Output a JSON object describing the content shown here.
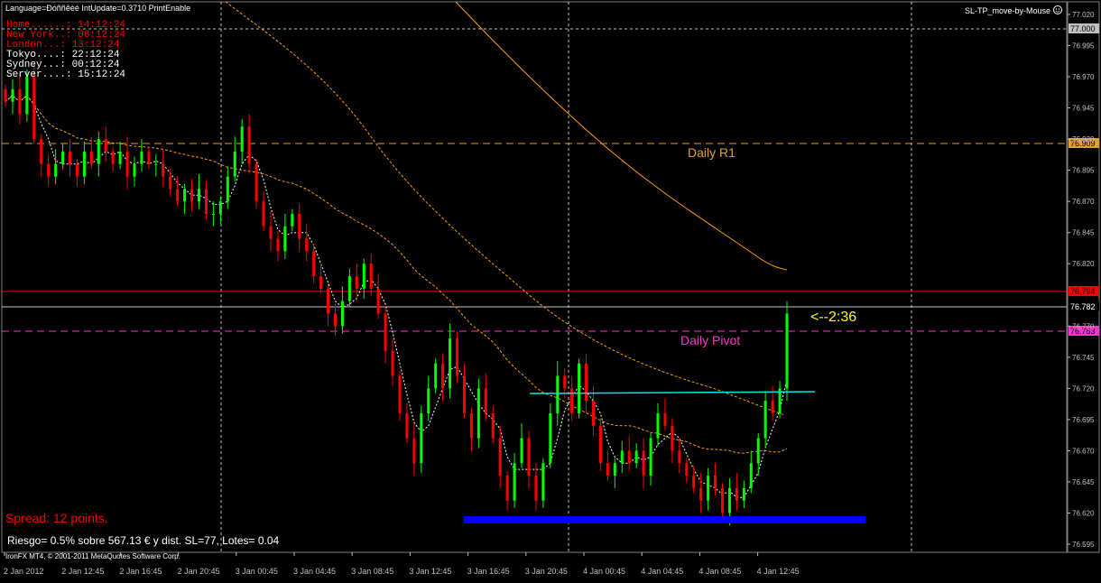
{
  "header": {
    "status_line": "Language=Ðóññêèé  IntUpdate=0.3710  PrintEnable",
    "indicator_name": "SL-TP_move-by-Mouse",
    "smiley_icon": "smiley-icon"
  },
  "clocks": [
    {
      "label": "Home......:",
      "time": "14:12:24",
      "color": "#ff0000"
    },
    {
      "label": "New York..:",
      "time": "08:12:24",
      "color": "#ff0000"
    },
    {
      "label": "London...:",
      "time": "13:12:24",
      "color": "#ff0000"
    },
    {
      "label": "Tokyo....:",
      "time": "22:12:24",
      "color": "#ffffff"
    },
    {
      "label": "Sydney...:",
      "time": "00:12:24",
      "color": "#ffffff"
    },
    {
      "label": "Server....:",
      "time": "15:12:24",
      "color": "#ffffff"
    }
  ],
  "levels": {
    "daily_r1": {
      "label": "Daily R1",
      "price": "76.909",
      "color": "#e0a030"
    },
    "daily_pivot": {
      "label": "Daily Pivot",
      "price": "76.763",
      "color": "#ff33cc"
    },
    "red_level": {
      "price": "76.794",
      "color": "#ff0000"
    },
    "bid": {
      "price": "76.782"
    },
    "top_level": {
      "price": "77.000"
    }
  },
  "countdown": "<--2:36",
  "spread_text": "Spread: 12 points.",
  "risk_text": "Riesgo= 0.5% sobre 567.13 € y dist. SL=77, Lotes= 0.04",
  "copyright": "IronFX MT4, © 2001-2011 MetaQuotes Software Corp.",
  "price_axis": [
    "77.020",
    "76.995",
    "76.970",
    "76.945",
    "76.920",
    "76.895",
    "76.870",
    "76.845",
    "76.820",
    "76.770",
    "76.745",
    "76.720",
    "76.695",
    "76.670",
    "76.645",
    "76.620",
    "76.595"
  ],
  "time_axis": [
    "2 Jan 2012",
    "2 Jan 12:45",
    "2 Jan 16:45",
    "2 Jan 20:45",
    "3 Jan 00:45",
    "3 Jan 04:45",
    "3 Jan 08:45",
    "3 Jan 12:45",
    "3 Jan 16:45",
    "3 Jan 20:45",
    "4 Jan 00:45",
    "4 Jan 04:45",
    "4 Jan 08:45",
    "4 Jan 12:45"
  ],
  "colors": {
    "bull": "#00ff00",
    "bear": "#ff0000",
    "wick": "#ffffff",
    "grid": "#c0c0c0",
    "ma_orange": "#ff9900",
    "ma_white": "#ffffff",
    "support": "#0000ff",
    "trendline": "#00e5e5"
  },
  "chart_data": {
    "type": "candlestick",
    "symbol_timeframe": "M15",
    "closes": [
      76.95,
      76.96,
      76.94,
      76.97,
      76.92,
      76.9,
      76.89,
      76.9,
      76.91,
      76.9,
      76.89,
      76.91,
      76.9,
      76.92,
      76.91,
      76.9,
      76.91,
      76.89,
      76.9,
      76.91,
      76.9,
      76.9,
      76.89,
      76.88,
      76.87,
      76.88,
      76.87,
      76.88,
      76.86,
      76.86,
      76.87,
      76.89,
      76.91,
      76.93,
      76.9,
      76.87,
      76.85,
      76.84,
      76.83,
      76.85,
      76.86,
      76.84,
      76.83,
      76.81,
      76.8,
      76.78,
      76.77,
      76.79,
      76.81,
      76.8,
      76.82,
      76.8,
      76.78,
      76.75,
      76.73,
      76.7,
      76.68,
      76.66,
      76.7,
      76.72,
      76.74,
      76.72,
      76.76,
      76.73,
      76.7,
      76.68,
      76.72,
      76.7,
      76.68,
      76.65,
      76.63,
      76.66,
      76.68,
      76.65,
      76.63,
      76.66,
      76.7,
      76.73,
      76.72,
      76.7,
      76.74,
      76.71,
      76.69,
      76.66,
      76.65,
      76.66,
      76.67,
      76.66,
      76.67,
      76.65,
      76.68,
      76.7,
      76.69,
      76.67,
      76.66,
      76.65,
      76.64,
      76.63,
      76.65,
      76.64,
      76.62,
      76.64,
      76.63,
      76.64,
      76.66,
      76.68,
      76.71,
      76.7,
      76.72,
      76.78
    ],
    "moving_averages": [
      "orange dashed",
      "orange solid",
      "white dotted"
    ]
  }
}
